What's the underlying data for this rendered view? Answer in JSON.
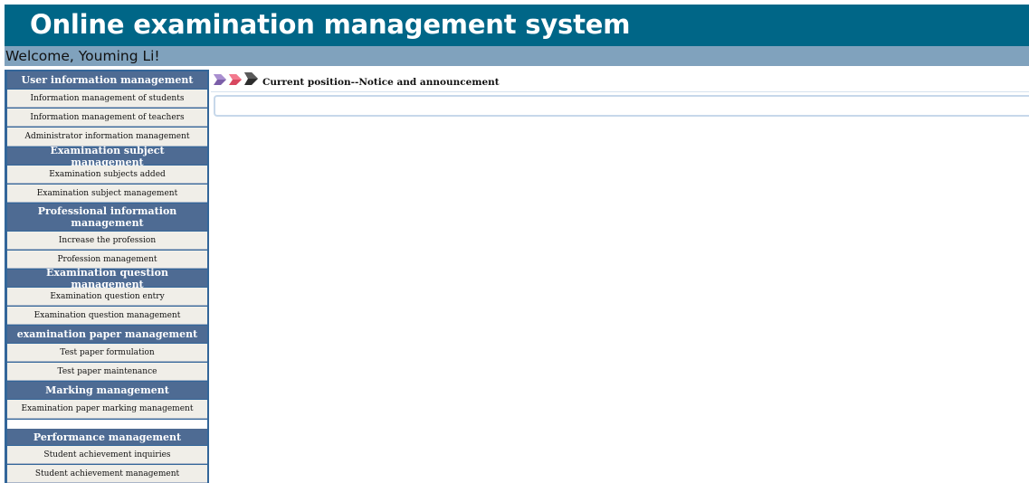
{
  "header": {
    "title": "Online examination management system"
  },
  "welcome": {
    "text": "Welcome, Youming Li!"
  },
  "sidebar": {
    "groups": [
      {
        "title": "User information management",
        "items": [
          "Information management of students",
          "Information management of teachers",
          "Administrator information management"
        ]
      },
      {
        "title": "Examination subject management",
        "items": [
          "Examination subjects added",
          "Examination subject management"
        ]
      },
      {
        "title": "Professional information management",
        "items": [
          "Increase the profession",
          "Profession management"
        ]
      },
      {
        "title": "Examination question management",
        "items": [
          "Examination question entry",
          "Examination question management"
        ]
      },
      {
        "title": "examination paper management",
        "items": [
          "Test paper formulation",
          "Test paper maintenance"
        ]
      },
      {
        "title": "Marking management",
        "items": [
          "Examination paper marking management"
        ]
      },
      {
        "title": "Performance management",
        "items": [
          "Student achievement inquiries",
          "Student achievement management"
        ]
      }
    ]
  },
  "content": {
    "breadcrumb": "Current position--Notice and announcement",
    "arrow_icons": [
      "arrow-icon-purple",
      "arrow-icon-pink",
      "arrow-icon-dark"
    ]
  },
  "colors": {
    "header_bg": "#006687",
    "welcome_bg": "#80a2bd",
    "sidebar_border": "#336699",
    "category_bg": "#4e6b93",
    "item_bg": "#f0eee8"
  }
}
